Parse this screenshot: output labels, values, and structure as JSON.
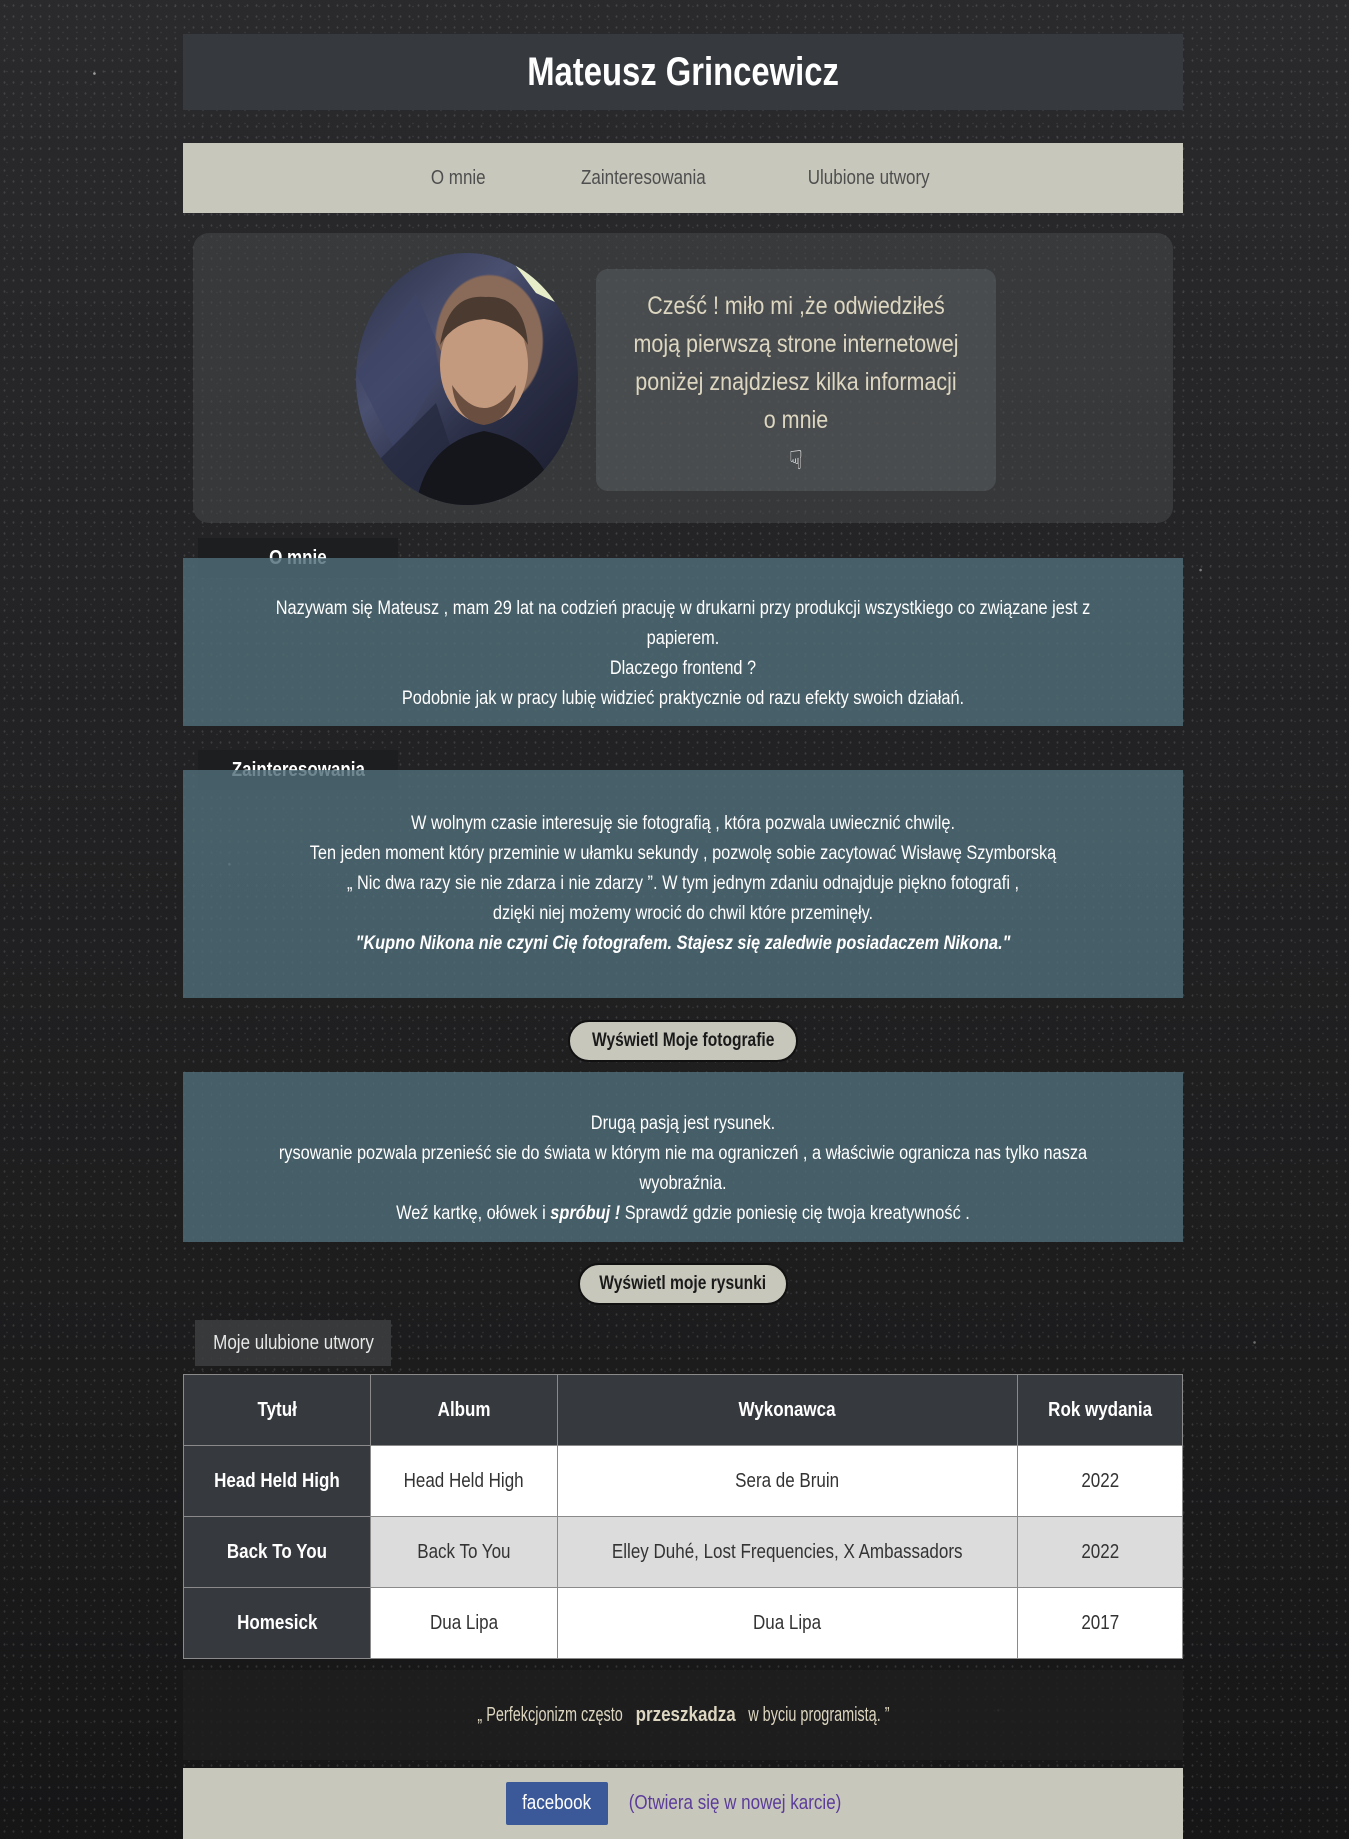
{
  "header": {
    "title": "Mateusz Grincewicz"
  },
  "nav": {
    "items": [
      "O mnie",
      "Zainteresowania",
      "Ulubione utwory"
    ]
  },
  "hero": {
    "greeting_lines": [
      "Cześć ! miło mi ,że odwiedziłeś",
      "moją pierwszą strone internetowej",
      "poniżej znajdziesz kilka informacji",
      "o mnie"
    ],
    "hand_icon": "☟"
  },
  "about": {
    "title": "O mnie",
    "lines": [
      "Nazywam się Mateusz , mam 29 lat na codzień pracuję w drukarni przy produkcji wszystkiego co związane jest z papierem.",
      "Dlaczego frontend ?",
      "Podobnie jak w pracy lubię widzieć praktycznie od razu efekty swoich działań."
    ]
  },
  "interests": {
    "title": "Zainteresowania",
    "lines": [
      "W wolnym czasie interesuję sie fotografią , która pozwala uwiecznić chwilę.",
      "Ten jeden moment który przeminie w ułamku sekundy , pozwolę sobie zacytować Wisławę Szymborską",
      "„ Nic dwa razy sie nie zdarza i nie zdarzy ”. W tym jednym zdaniu odnajduje piękno fotografi ,",
      "dzięki niej możemy wrocić do chwil które przeminęły."
    ],
    "quote": "\"Kupno Nikona nie czyni Cię fotografem. Stajesz się zaledwie posiadaczem Nikona.\""
  },
  "photos_button": "Wyświetl Moje fotografie",
  "drawing": {
    "line1": "Drugą pasją jest rysunek.",
    "line2": "rysowanie pozwala przenieść sie do świata w którym nie ma ograniczeń , a właściwie ogranicza nas tylko nasza wyobraźnia.",
    "line3_before": "Weź kartkę, ołówek i ",
    "line3_em": "spróbuj !",
    "line3_after": " Sprawdź gdzie poniesię cię twoja kreatywność ."
  },
  "drawings_button": "Wyświetl moje rysunki",
  "songs": {
    "label": "Moje ulubione utwory",
    "headers": [
      "Tytuł",
      "Album",
      "Wykonawca",
      "Rok wydania"
    ],
    "rows": [
      [
        "Head Held High",
        "Head Held High",
        "Sera de Bruin",
        "2022"
      ],
      [
        "Back To You",
        "Back To You",
        "Elley Duhé, Lost Frequencies, X Ambassadors",
        "2022"
      ],
      [
        "Homesick",
        "Dua Lipa",
        "Dua Lipa",
        "2017"
      ]
    ]
  },
  "footer_quote": {
    "before": "„ Perfekcjonizm często ",
    "strong": "przeszkadza",
    "after": " w byciu programistą. ”"
  },
  "footer": {
    "facebook_label": "facebook",
    "new_tab_note": "(Otwiera się w nowej karcie)"
  },
  "colors": {
    "header_bg": "#363a3f",
    "nav_bg": "#c8c7bc",
    "panel_bg": "#4f6d78",
    "facebook": "#3b5998"
  }
}
